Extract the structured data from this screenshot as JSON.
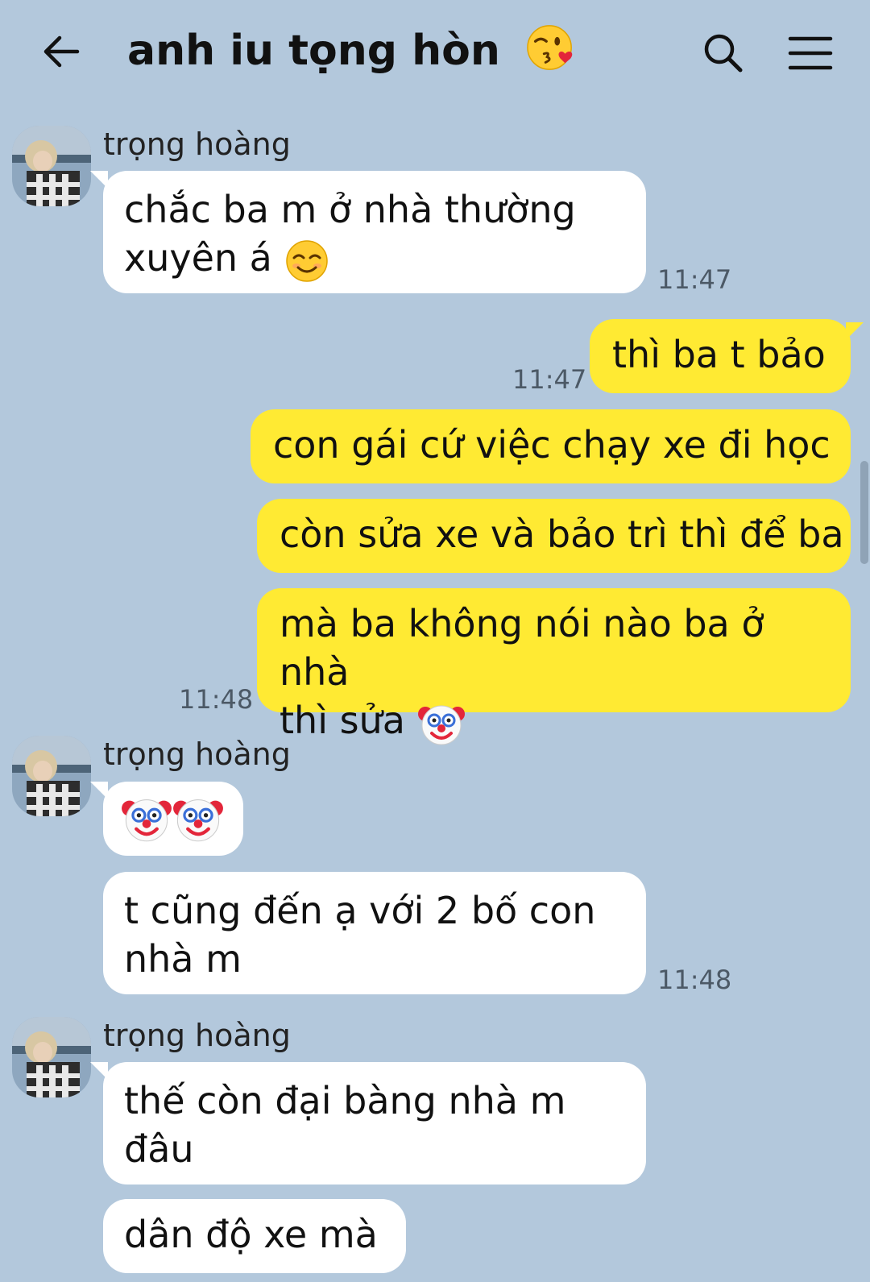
{
  "header": {
    "title": "anh iu tọng hòn",
    "title_emoji": "face-blowing-a-kiss",
    "back_icon": "back-arrow-icon",
    "search_icon": "search-icon",
    "menu_icon": "menu-icon"
  },
  "colors": {
    "background": "#b3c8dc",
    "incoming_bubble": "#ffffff",
    "outgoing_bubble": "#ffea33",
    "timestamp": "#4c5966"
  },
  "messages": [
    {
      "sender": "trọng hoàng",
      "text": "chắc ba m ở nhà thường",
      "text2": "xuyên á",
      "emoji": "smiling-face-with-smiling-eyes",
      "time": "11:47"
    },
    {
      "sender": "me",
      "text": "thì ba t bảo",
      "time": "11:47"
    },
    {
      "sender": "me",
      "text": "con gái cứ việc chạy xe đi học"
    },
    {
      "sender": "me",
      "text": "còn sửa xe và bảo trì thì để ba"
    },
    {
      "sender": "me",
      "text": "mà ba không nói nào ba ở nhà",
      "text2": "thì sửa",
      "emoji": "clown-face",
      "time": "11:48"
    },
    {
      "sender": "trọng hoàng",
      "emoji": "clown-face x2"
    },
    {
      "sender": "trọng hoàng",
      "text": "t cũng đến ạ với 2 bố con",
      "text2": "nhà m",
      "time": "11:48"
    },
    {
      "sender": "trọng hoàng",
      "text": "thế còn đại bàng nhà m",
      "text2": "đâu"
    },
    {
      "sender": "trọng hoàng",
      "text": "dân độ xe mà"
    }
  ]
}
